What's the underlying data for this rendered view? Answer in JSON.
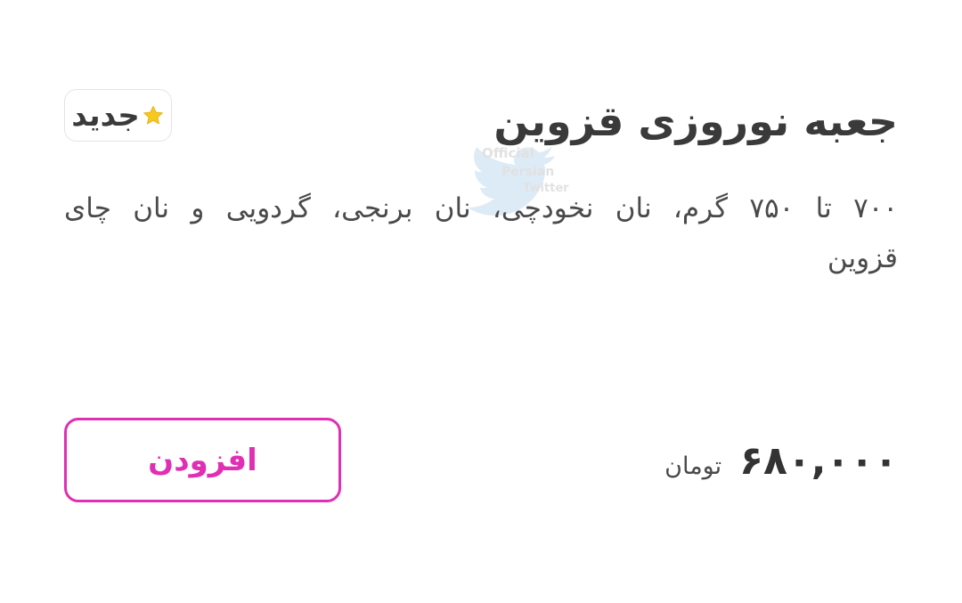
{
  "product": {
    "title": "جعبه نوروزی قزوین",
    "badge": {
      "icon": "star-icon",
      "label": "جدید",
      "star_color": "#f7c81e"
    },
    "description": "۷۰۰ تا ۷۵۰ گرم، نان نخودچی، نان برنجی، گردویی و نان چای قزوین",
    "price": {
      "amount": "۶۸۰,۰۰۰",
      "currency": "تومان"
    },
    "add_button_label": "افزودن",
    "accent_color": "#e02fb4"
  },
  "watermark": {
    "lines": [
      "Official",
      "Persian",
      "Twitter"
    ],
    "icon": "twitter-bird-icon"
  }
}
